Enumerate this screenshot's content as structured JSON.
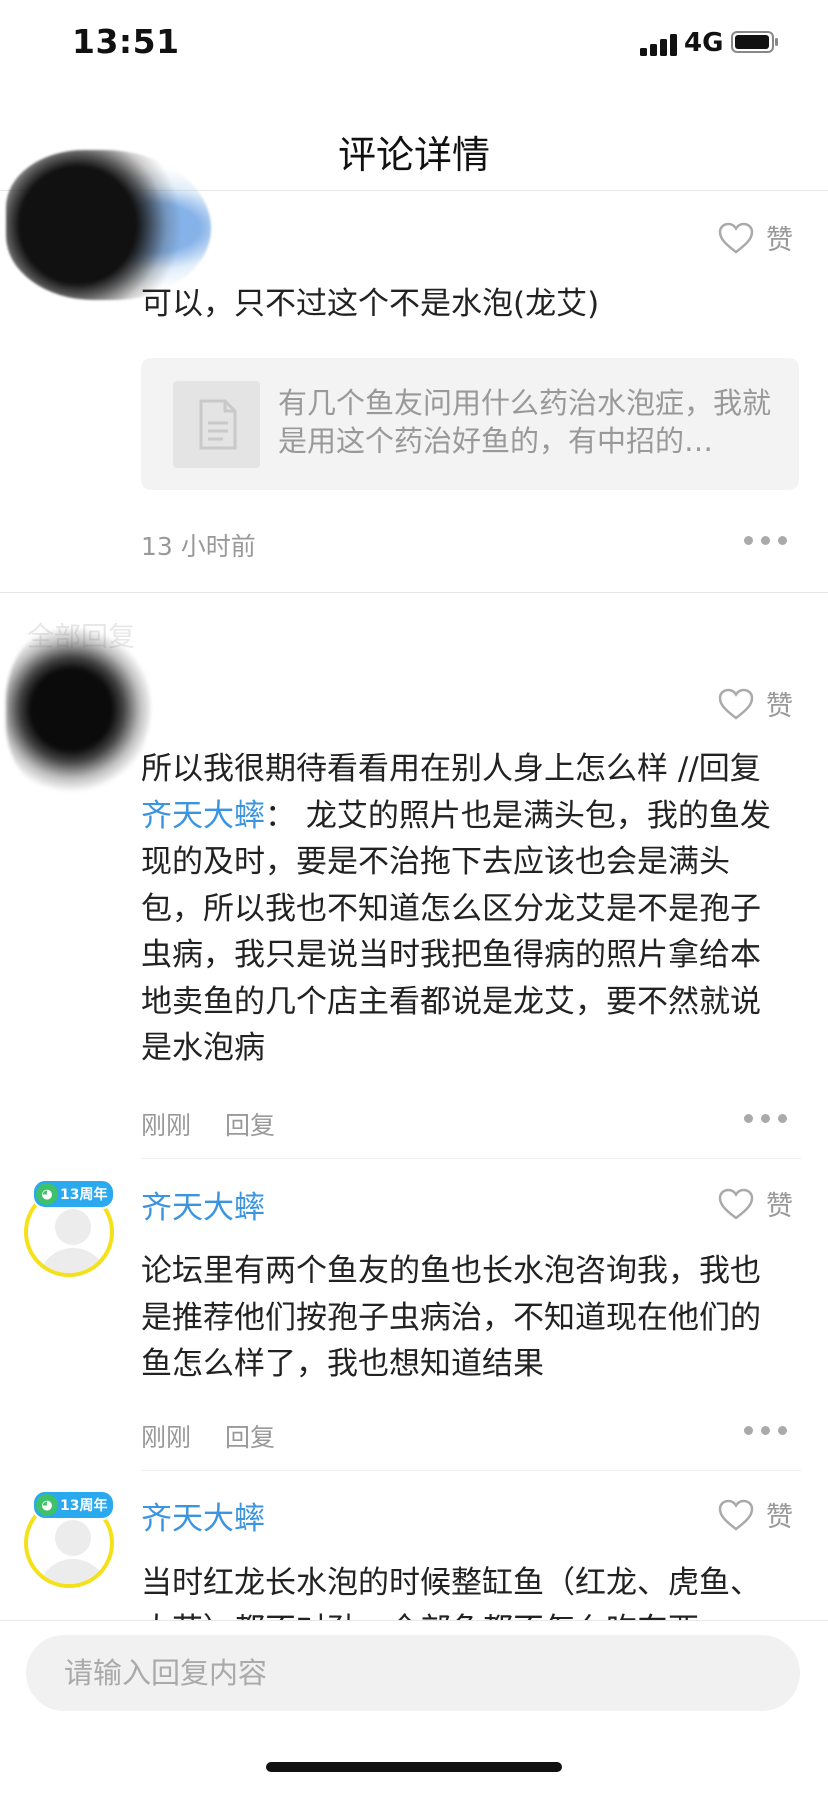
{
  "status_bar": {
    "time": "13:51",
    "network": "4G"
  },
  "header": {
    "title": "评论详情"
  },
  "main_comment": {
    "like_label": "赞",
    "text": "可以，只不过这个不是水泡(龙艾)",
    "quote_text": "有几个鱼友问用什么药治水泡症，我就是用这个药治好鱼的，有中招的…",
    "time": "13 小时前"
  },
  "replies_section": {
    "label": "全部回复"
  },
  "replies": [
    {
      "like_label": "赞",
      "text_before": "所以我很期待看看用在别人身上怎么样  //回复 ",
      "mention": "齐天大蟀",
      "text_after": "： 龙艾的照片也是满头包，我的鱼发现的及时，要是不治拖下去应该也会是满头包，所以我也不知道怎么区分龙艾是不是孢子虫病，我只是说当时我把鱼得病的照片拿给本地卖鱼的几个店主看都说是龙艾，要不然就说是水泡病",
      "time": "刚刚",
      "reply_label": "回复"
    },
    {
      "badge": "13周年",
      "username": "齐天大蟀",
      "like_label": "赞",
      "text": "论坛里有两个鱼友的鱼也长水泡咨询我，我也是推荐他们按孢子虫病治，不知道现在他们的鱼怎么样了，我也想知道结果",
      "time": "刚刚",
      "reply_label": "回复"
    },
    {
      "badge": "13周年",
      "username": "齐天大蟀",
      "like_label": "赞",
      "text": "当时红龙长水泡的时候整缸鱼（红龙、虎鱼、大花）都不对劲，全部鱼都不怎么吃东西"
    }
  ],
  "input": {
    "placeholder": "请输入回复内容"
  },
  "colors": {
    "accent": "#3b94e0",
    "badge_ring": "#f5e11b"
  }
}
